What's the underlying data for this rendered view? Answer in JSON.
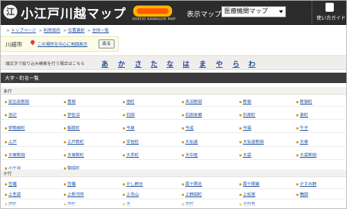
{
  "header": {
    "logo_mark": "江",
    "title": "小江戸川越マップ",
    "badge_sub": "KOEDO KAWAGOE MAP",
    "map_label": "表示マップ：",
    "map_select_value": "医療機関マップ",
    "guide_label": "使い方ガイド"
  },
  "breadcrumb": {
    "items": [
      "トップページ",
      "利用目的",
      "位置選択",
      "住所一覧"
    ],
    "separator": ">"
  },
  "location": {
    "city": "川越市",
    "center_link": "この場所を中心に地図表示",
    "back_button": "戻る"
  },
  "kana_filter": {
    "label": "頭文字で絞り込み検索を行う場合はこちら",
    "letters": [
      "あ",
      "か",
      "さ",
      "た",
      "な",
      "は",
      "ま",
      "や",
      "ら",
      "わ"
    ]
  },
  "section": {
    "title": "大字・町名一覧"
  },
  "groups": [
    {
      "title": "あ行",
      "rows": [
        [
          "安比奈新田",
          "青柳",
          "旭町",
          "天沼新田",
          "新宿",
          "新宿町"
        ],
        [
          "池辺",
          "伊佐沼",
          "石田",
          "石田本郷",
          "石原町",
          "泉町"
        ],
        [
          "伊勢原町",
          "稲荷町",
          "今泉",
          "今成",
          "今福",
          "牛子"
        ],
        [
          "上戸",
          "上戸新町",
          "宇佐町",
          "大仙波",
          "大仙波新田",
          "大塚"
        ],
        [
          "大塚新田",
          "大塚新町",
          "大手町",
          "大中居",
          "大袋",
          "大袋新田"
        ],
        [
          "小ケ谷",
          "御成町"
        ]
      ]
    },
    {
      "title": "か行",
      "rows": [
        [
          "笠幡",
          "笠幡",
          "かし野台",
          "霞ケ関北",
          "霞ケ関東",
          "かすみ野"
        ],
        [
          "上老袋",
          "上新河岸",
          "上寺山",
          "上野田町",
          "上松原",
          "鴨田"
        ],
        [
          "岸町",
          "岸町",
          "北",
          "岸町",
          "北田島"
        ]
      ]
    }
  ]
}
